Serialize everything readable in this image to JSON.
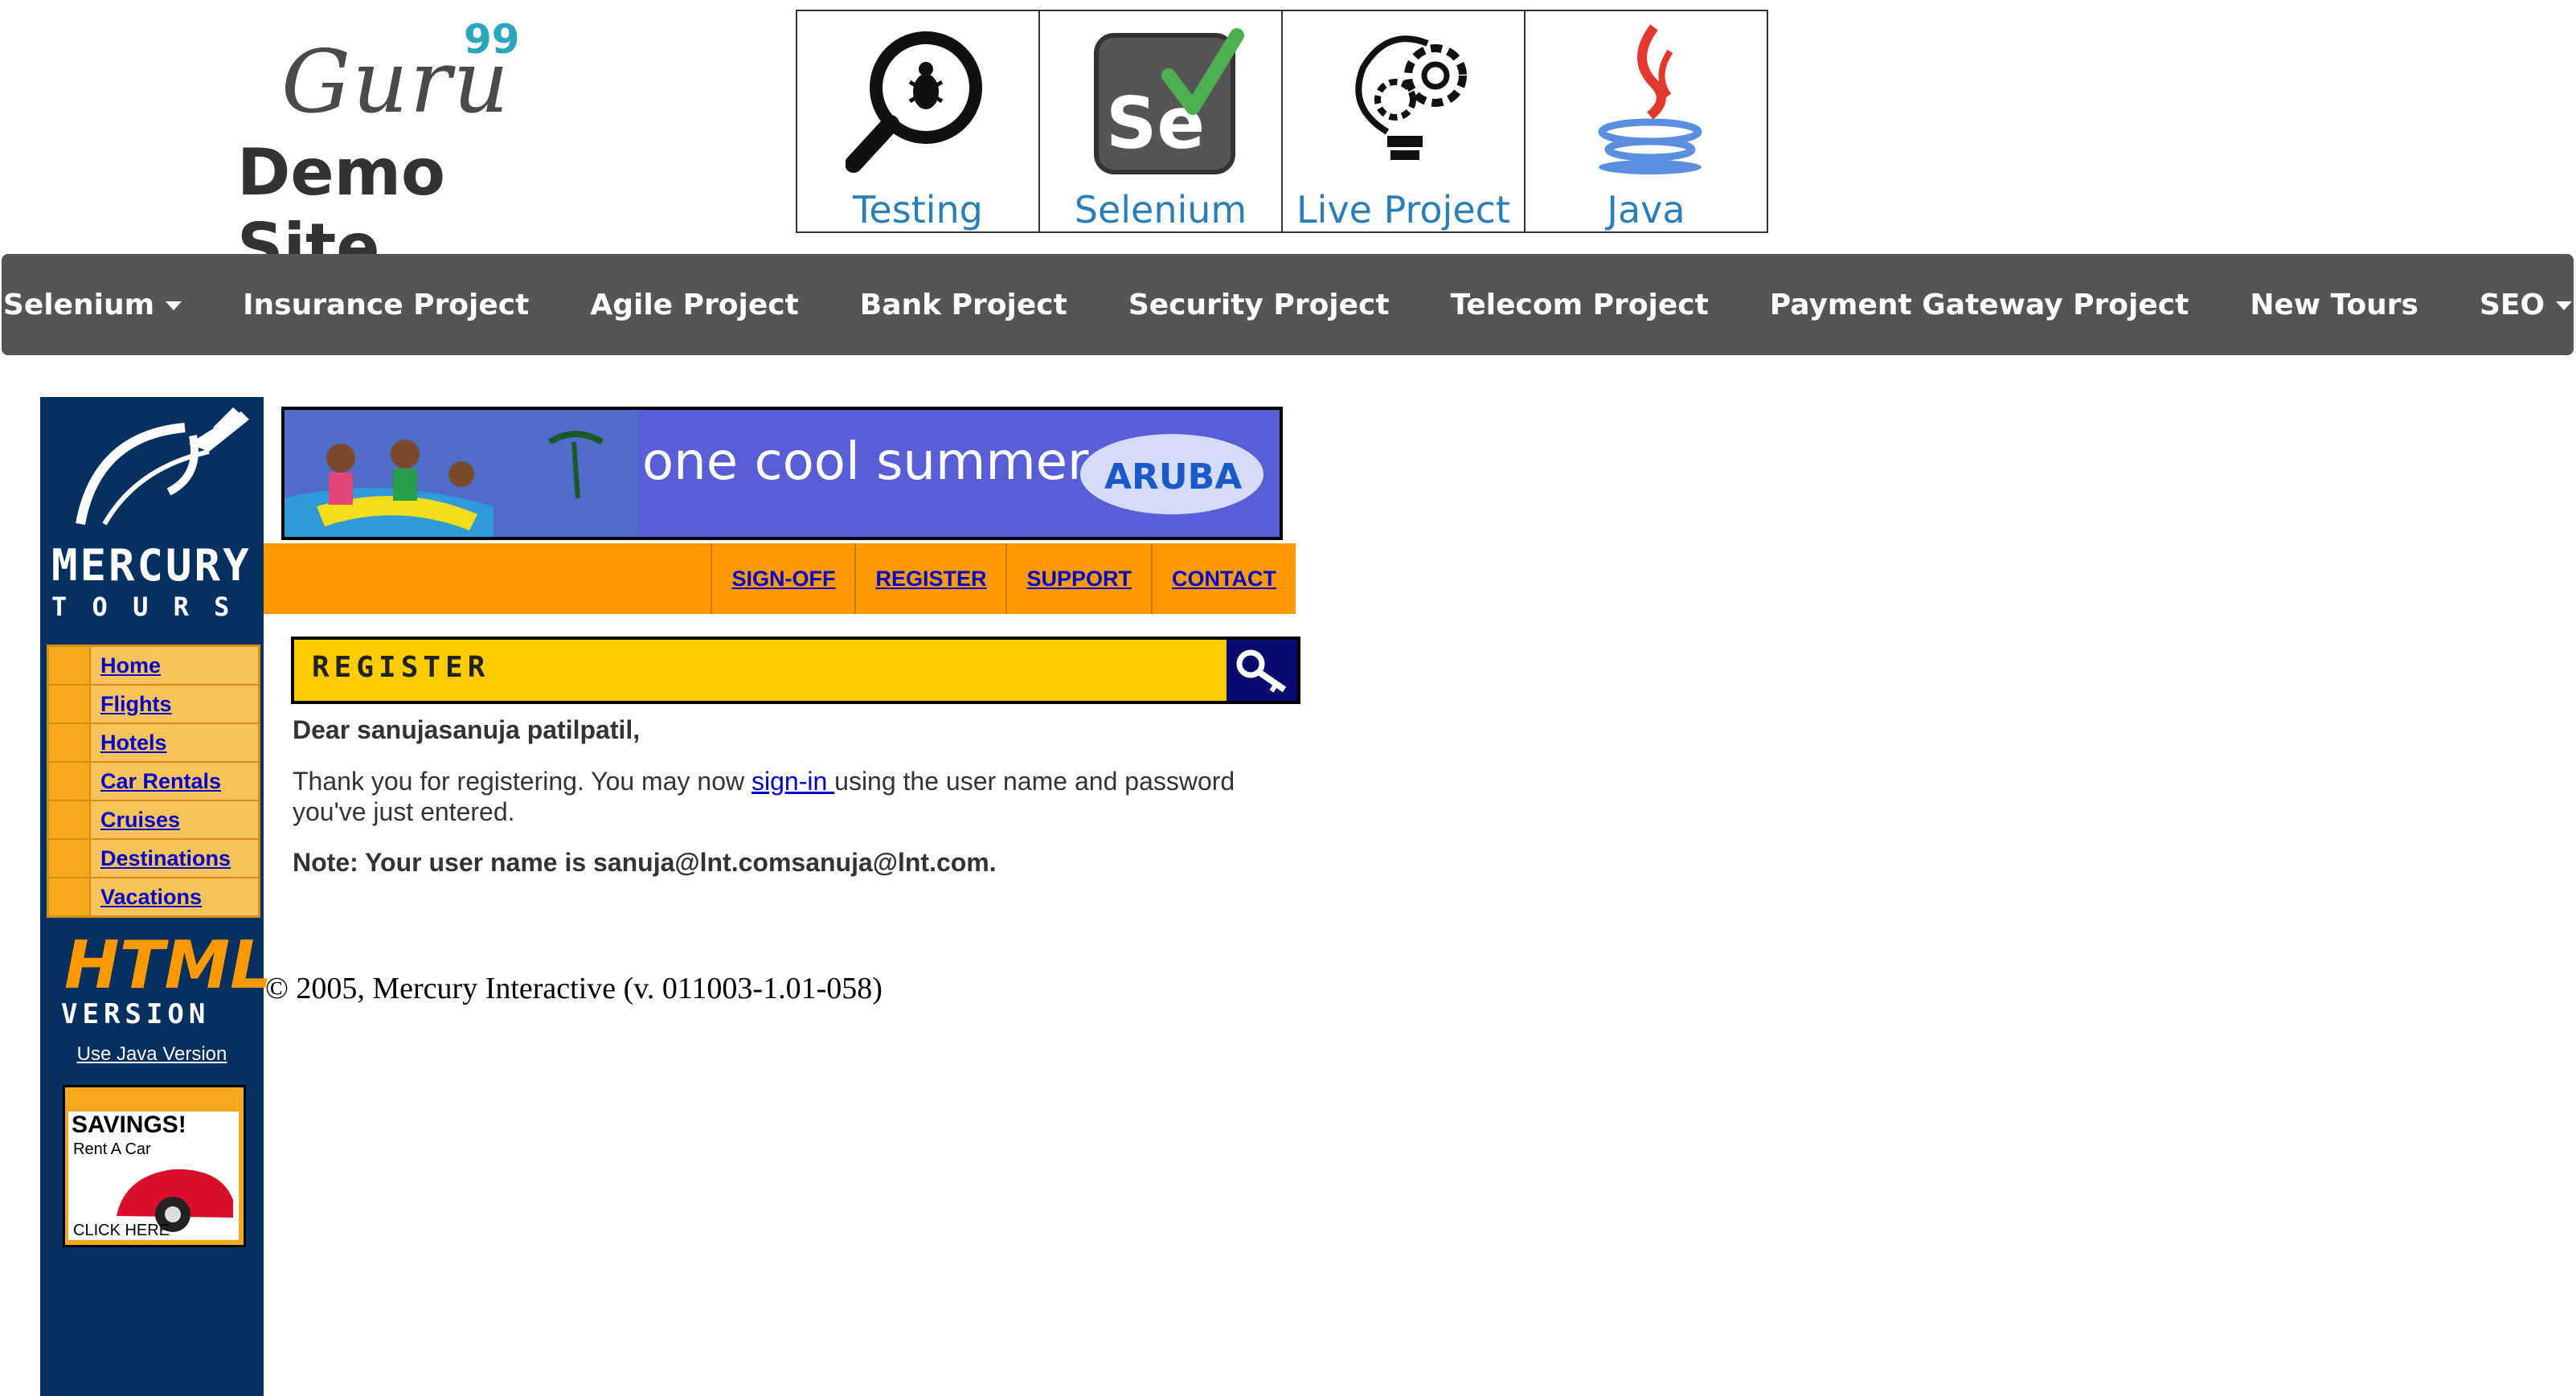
{
  "header": {
    "brand": "Guru",
    "brand_sup": "99",
    "site_title": "Demo Site",
    "tiles": [
      {
        "label": "Testing",
        "icon": "magnifier-bug-icon"
      },
      {
        "label": "Selenium",
        "icon": "selenium-icon"
      },
      {
        "label": "Live Project",
        "icon": "lightbulb-gear-icon"
      },
      {
        "label": "Java",
        "icon": "java-cup-icon"
      }
    ]
  },
  "navbar": {
    "items": [
      {
        "label": "Selenium",
        "dropdown": true
      },
      {
        "label": "Insurance Project"
      },
      {
        "label": "Agile Project"
      },
      {
        "label": "Bank Project"
      },
      {
        "label": "Security Project"
      },
      {
        "label": "Telecom Project"
      },
      {
        "label": "Payment Gateway Project"
      },
      {
        "label": "New Tours"
      },
      {
        "label": "SEO",
        "dropdown": true
      }
    ]
  },
  "mercury": {
    "logo_line1": "MERCURY",
    "logo_line2": "T O U R S",
    "banner_text": "one cool summer",
    "banner_brand": "ARUBA",
    "top_links": [
      "SIGN-OFF",
      "REGISTER",
      "SUPPORT",
      "CONTACT"
    ],
    "side_menu": [
      "Home",
      "Flights",
      "Hotels",
      "Car Rentals",
      "Cruises",
      "Destinations",
      "Vacations"
    ],
    "html_version_line1": "HTML",
    "html_version_line2": "VERSION",
    "java_link": "Use Java Version",
    "savings_title": "SAVINGS!",
    "savings_sub": "Rent A Car",
    "savings_click": "CLICK HERE",
    "page_heading": "REGISTER",
    "dear": "Dear sanujasanuja patilpatil,",
    "thanks_before": "Thank you for registering. You may now ",
    "signin_link": "sign-in ",
    "thanks_after": "using the user name and password you've just entered.",
    "note": "Note: Your user name is sanuja@lnt.comsanuja@lnt.com.",
    "copyright": "© 2005, Mercury Interactive (v. 011003-1.01-058)"
  },
  "colors": {
    "navbar": "#555555",
    "sidebar": "#06305f",
    "orange": "#ff9900",
    "yellow": "#ffcc00",
    "link": "#0000cc",
    "tile_label": "#2a7fb8"
  }
}
